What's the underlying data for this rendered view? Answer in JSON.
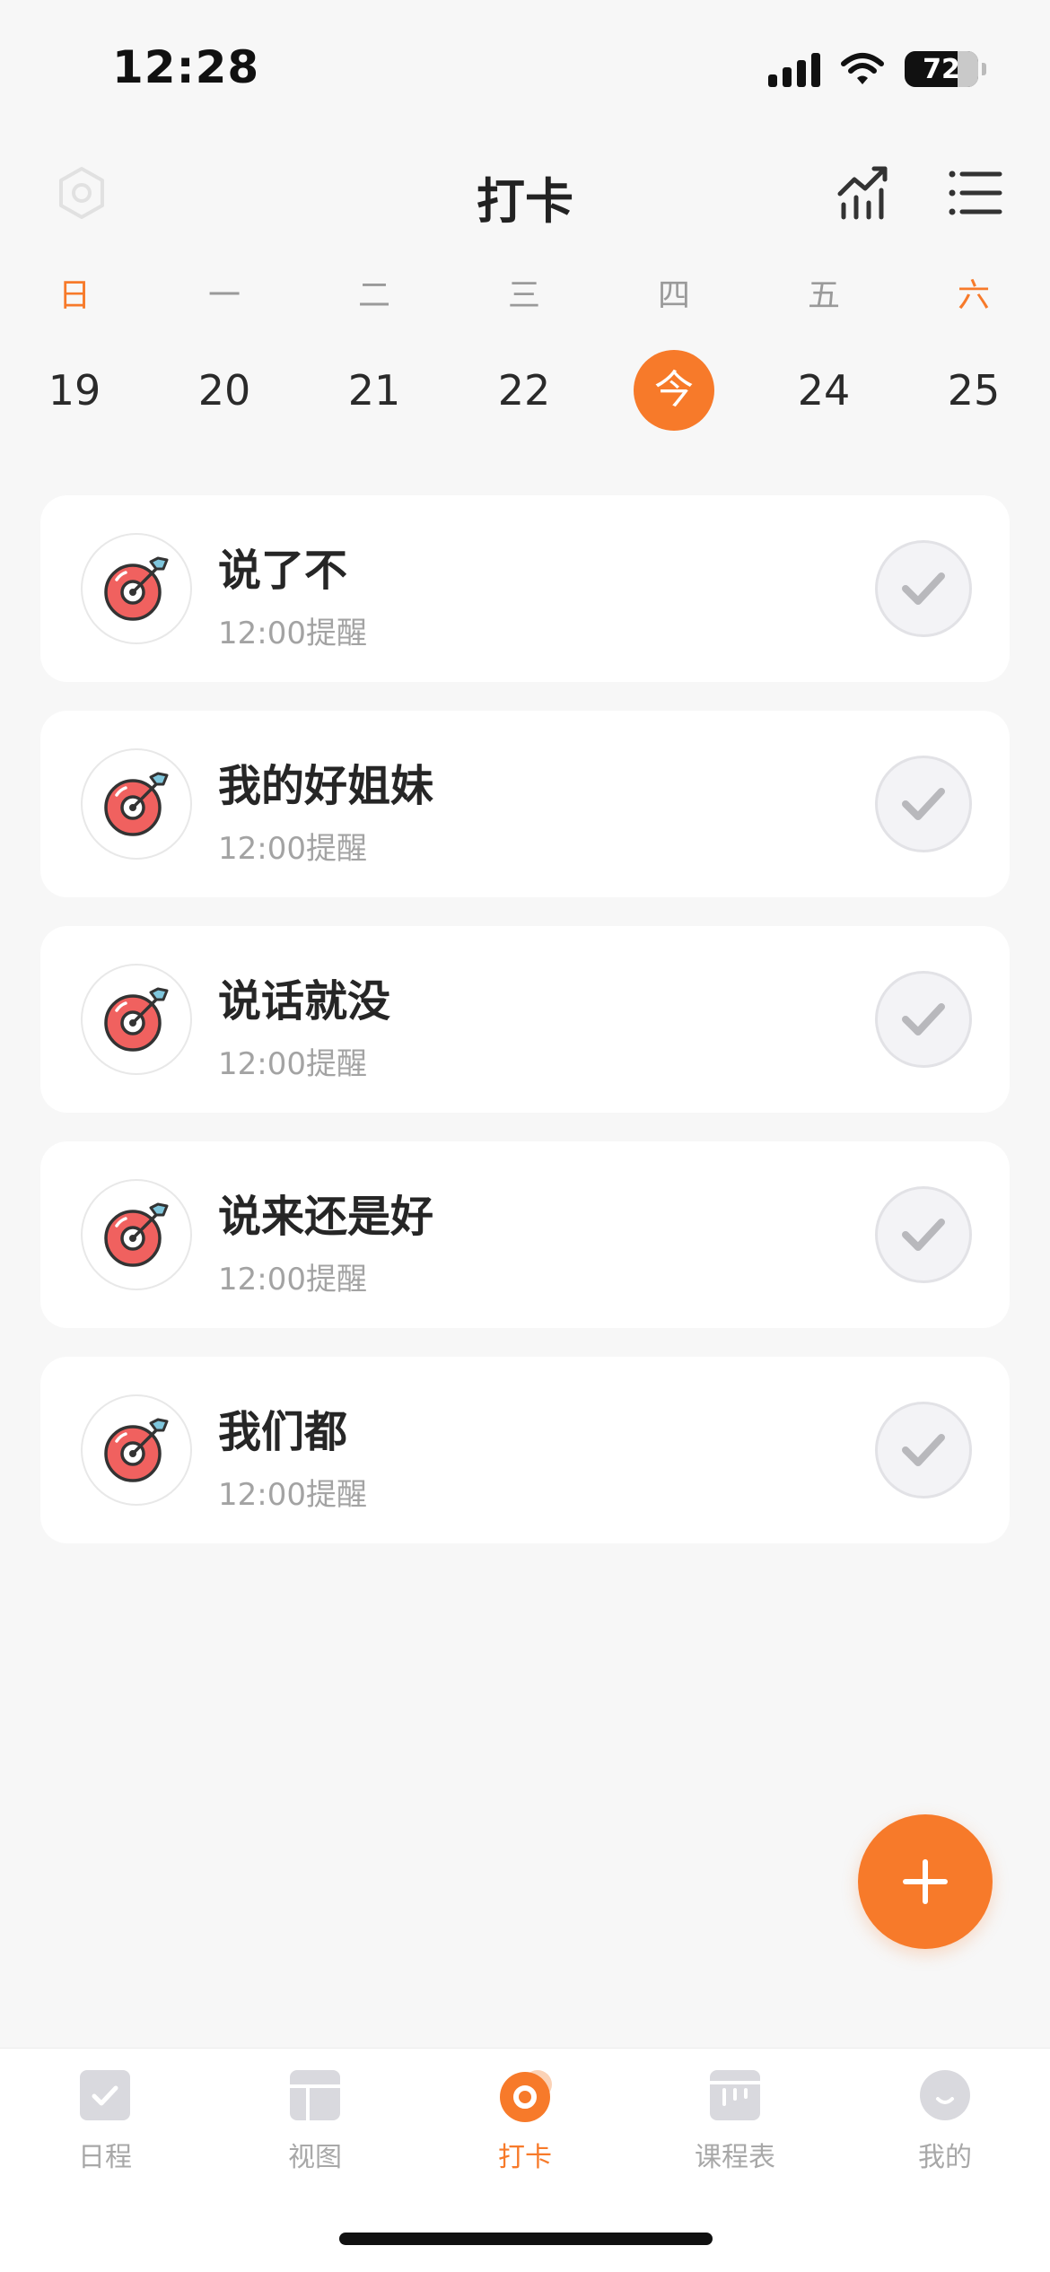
{
  "status": {
    "time": "12:28",
    "battery": "72",
    "battery_level": 0.72
  },
  "header": {
    "title": "打卡"
  },
  "week": {
    "days": [
      {
        "weekday": "日",
        "date": "19",
        "weekend": true
      },
      {
        "weekday": "一",
        "date": "20"
      },
      {
        "weekday": "二",
        "date": "21"
      },
      {
        "weekday": "三",
        "date": "22"
      },
      {
        "weekday": "四",
        "date": "今",
        "today": true
      },
      {
        "weekday": "五",
        "date": "24"
      },
      {
        "weekday": "六",
        "date": "25",
        "weekend": true
      }
    ]
  },
  "habits": [
    {
      "title": "说了不",
      "reminder": "12:00提醒"
    },
    {
      "title": "我的好姐妹",
      "reminder": "12:00提醒"
    },
    {
      "title": "说话就没",
      "reminder": "12:00提醒"
    },
    {
      "title": "说来还是好",
      "reminder": "12:00提醒"
    },
    {
      "title": "我们都",
      "reminder": "12:00提醒"
    }
  ],
  "tabs": [
    {
      "label": "日程",
      "icon": "schedule-check-icon"
    },
    {
      "label": "视图",
      "icon": "view-layout-icon"
    },
    {
      "label": "打卡",
      "icon": "checkin-ring-icon",
      "active": true
    },
    {
      "label": "课程表",
      "icon": "timetable-icon"
    },
    {
      "label": "我的",
      "icon": "profile-face-icon"
    }
  ],
  "colors": {
    "accent": "#f77a2a",
    "target_red": "#f0615f",
    "arrow_blue": "#7fc6dc"
  }
}
